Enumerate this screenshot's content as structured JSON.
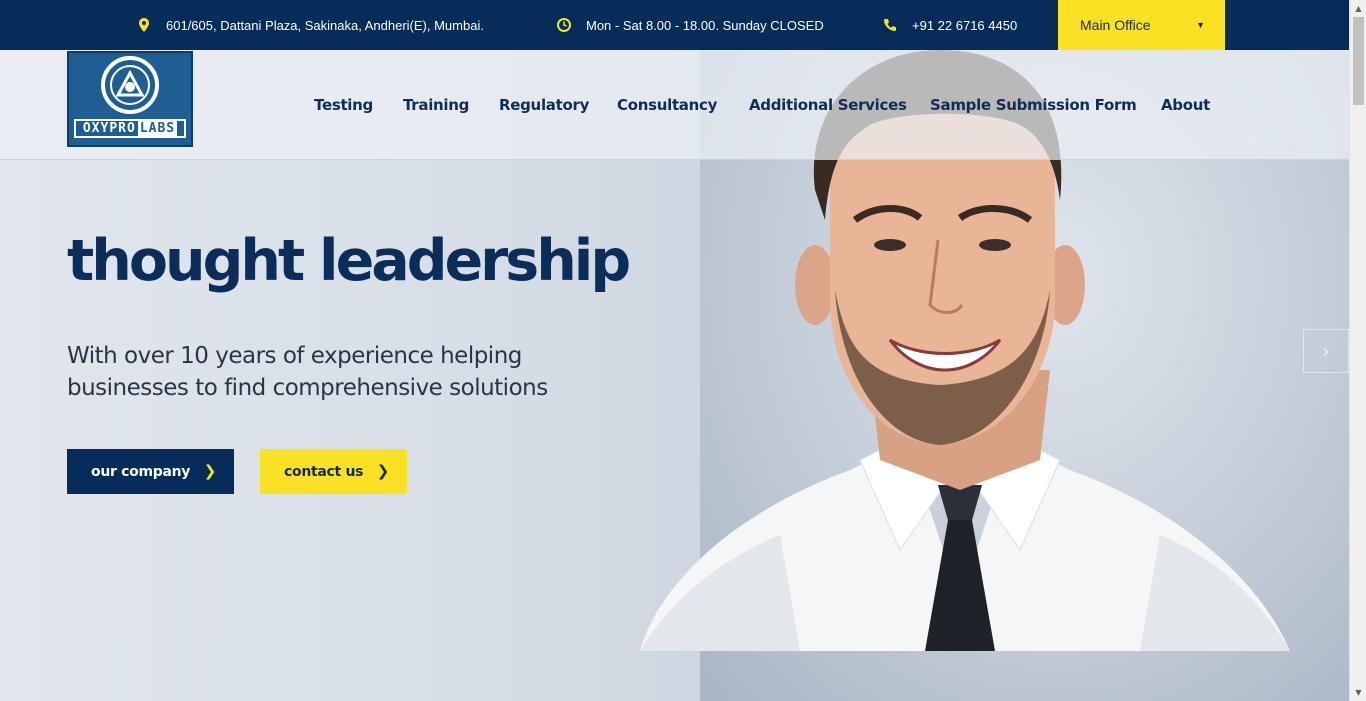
{
  "topbar": {
    "address": "601/605, Dattani Plaza, Sakinaka, Andheri(E), Mumbai.",
    "hours": "Mon - Sat 8.00 - 18.00. Sunday CLOSED",
    "phone": "+91 22 6716 4450",
    "office_select": "Main Office"
  },
  "logo": {
    "text_left": "OXYPRO",
    "text_right": "LABS"
  },
  "nav": [
    {
      "label": "Testing"
    },
    {
      "label": "Training"
    },
    {
      "label": "Regulatory"
    },
    {
      "label": "Consultancy"
    },
    {
      "label": "Additional Services"
    },
    {
      "label": "Sample Submission Form"
    },
    {
      "label": "About"
    }
  ],
  "hero": {
    "headline": "thought leadership",
    "subline": "With over 10 years of experience helping businesses to find comprehensive solutions",
    "btn_company": "our company",
    "btn_contact": "contact us"
  },
  "colors": {
    "navy": "#062c5a",
    "yellow": "#f9e224",
    "text_dark": "#0b2d5a"
  }
}
